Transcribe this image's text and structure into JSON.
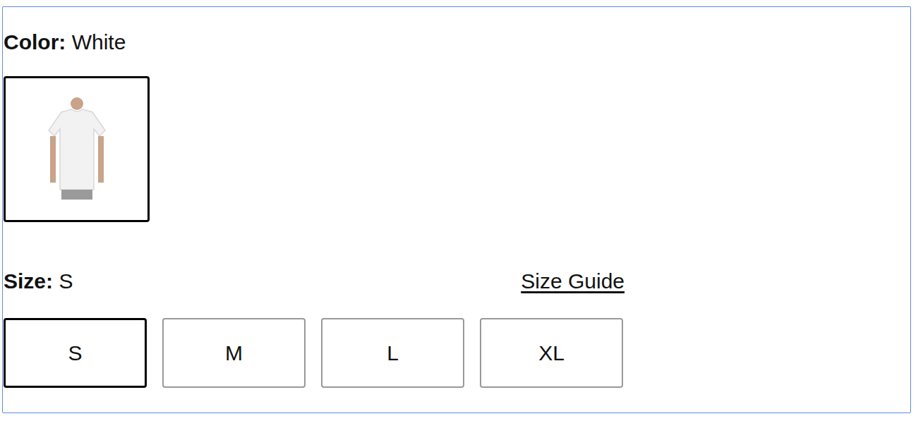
{
  "color": {
    "label": "Color:",
    "value": "White",
    "swatches": [
      {
        "selected": true
      }
    ]
  },
  "size": {
    "label": "Size:",
    "value": "S",
    "guide": "Size Guide",
    "options": [
      {
        "label": "S",
        "selected": true
      },
      {
        "label": "M",
        "selected": false
      },
      {
        "label": "L",
        "selected": false
      },
      {
        "label": "XL",
        "selected": false
      }
    ]
  }
}
